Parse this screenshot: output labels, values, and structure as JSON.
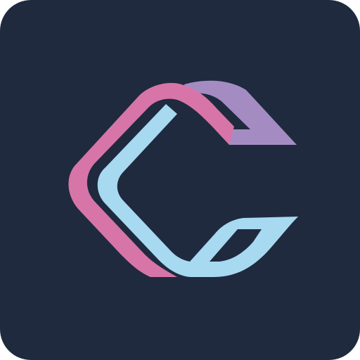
{
  "app_icon": {
    "name": "app-logo-icon",
    "colors": {
      "background": "#1F2A3E",
      "pink": "#D775A8",
      "purple": "#A48CC2",
      "light_blue": "#A7D9F1"
    }
  }
}
